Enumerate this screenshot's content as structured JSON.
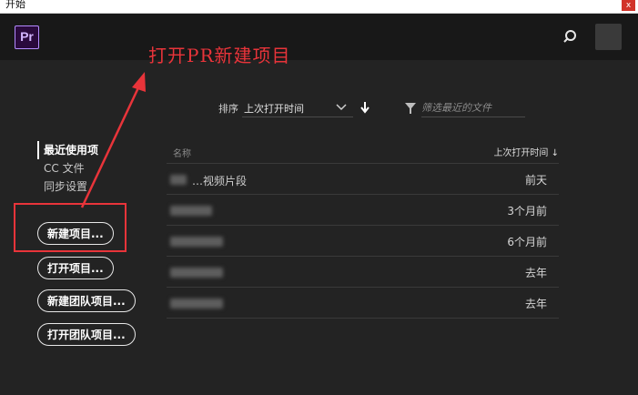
{
  "window": {
    "title": "开始",
    "close_glyph": "x"
  },
  "header": {
    "logo_text": "Pr",
    "search_icon": "search-icon",
    "avatar_icon": "user-avatar"
  },
  "annotation": {
    "text": "打开PR新建项目",
    "color": "#e8343a"
  },
  "nav": {
    "items": [
      "最近使用项",
      "CC 文件",
      "同步设置"
    ]
  },
  "actions": {
    "new_project": "新建项目...",
    "open_project": "打开项目...",
    "new_team_project": "新建团队项目...",
    "open_team_project": "打开团队项目..."
  },
  "sort": {
    "label": "排序",
    "value": "上次打开时间",
    "direction_icon": "arrow-down-icon"
  },
  "filter": {
    "placeholder": "筛选最近的文件",
    "icon": "funnel-icon"
  },
  "table": {
    "col_name": "名称",
    "col_time": "上次打开时间 ↓",
    "rows": [
      {
        "name": "…视频片段",
        "time": "前天"
      },
      {
        "name": "",
        "time": "3个月前"
      },
      {
        "name": "",
        "time": "6个月前"
      },
      {
        "name": "",
        "time": "去年"
      },
      {
        "name": "",
        "time": "去年"
      }
    ]
  },
  "colors": {
    "background": "#232323",
    "header": "#181818",
    "highlight": "#e8343a",
    "logo": "#b48bff"
  }
}
